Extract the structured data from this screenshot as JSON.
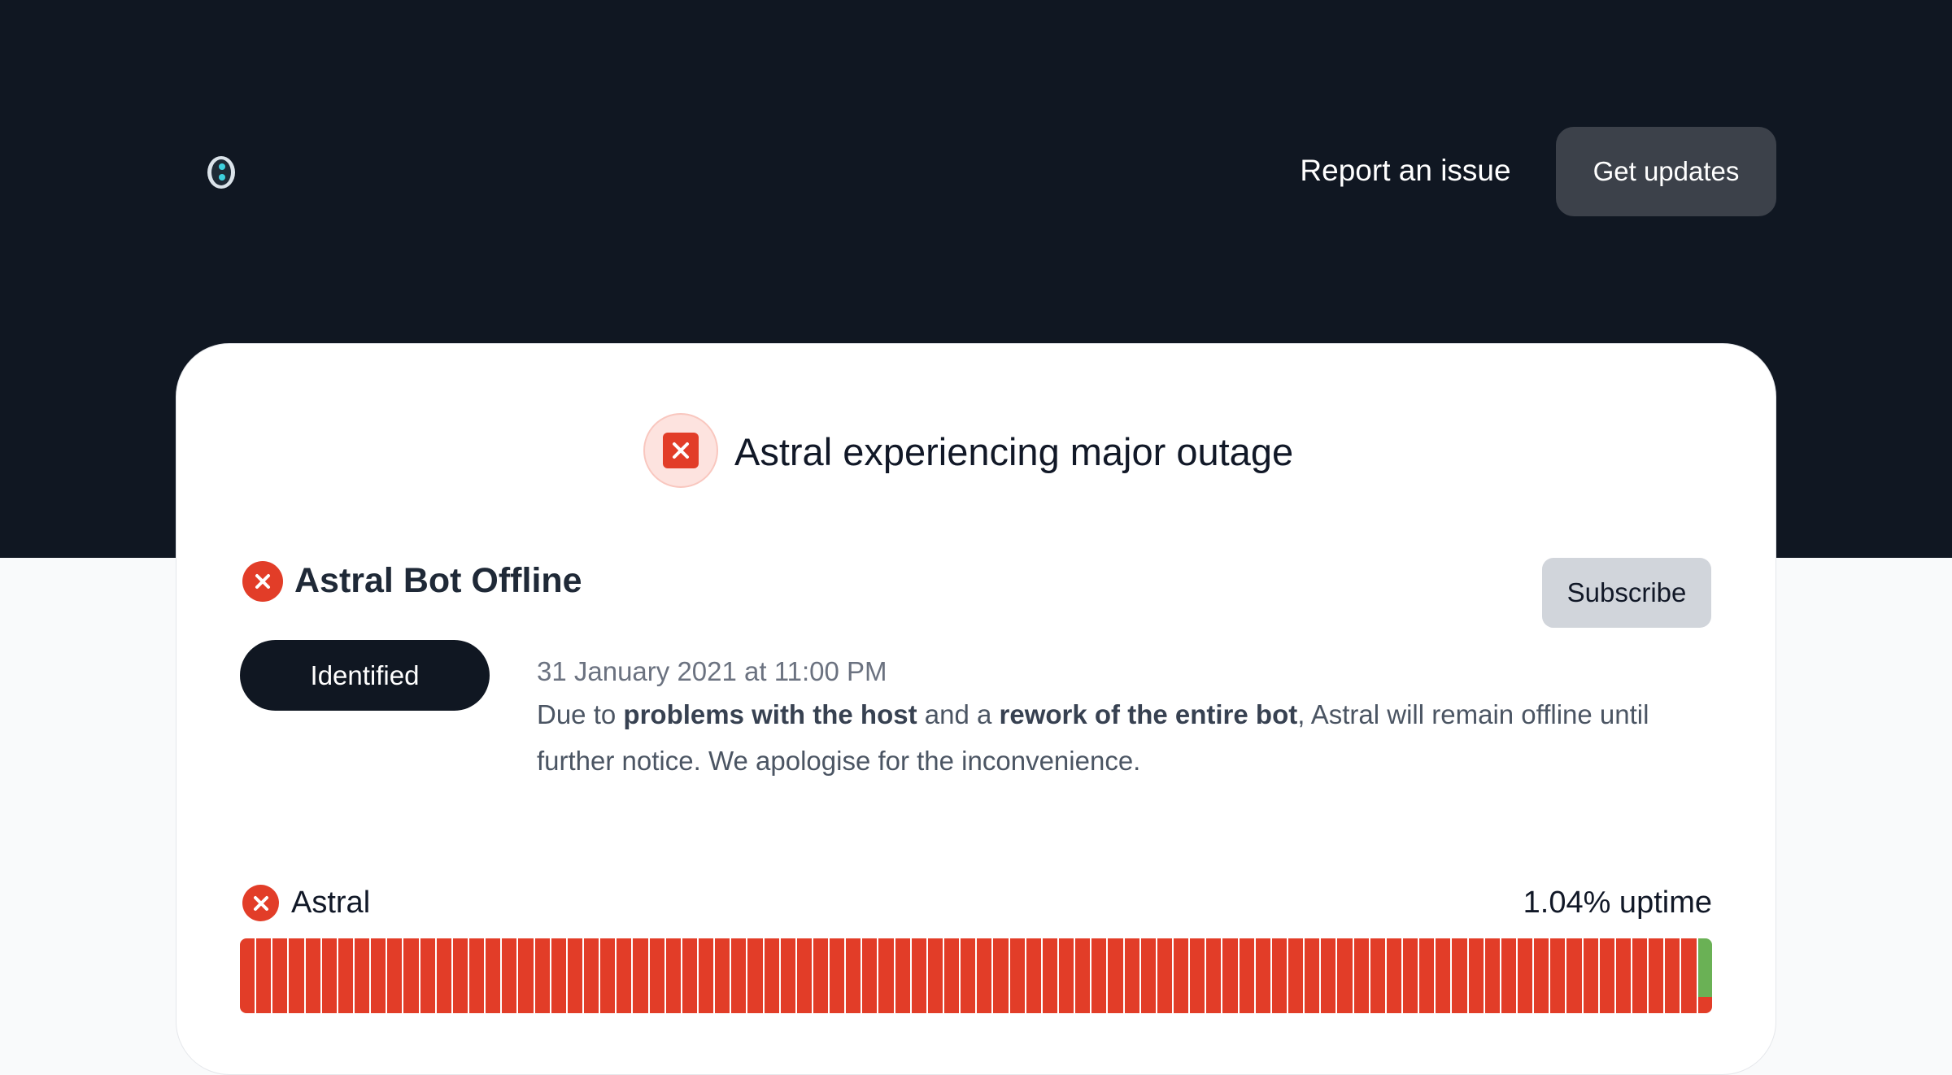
{
  "header": {
    "logo_icon": "astral-logo-icon",
    "report_link": "Report an issue",
    "get_updates_button": "Get updates"
  },
  "banner": {
    "icon": "x-square-icon",
    "title": "Astral experiencing major outage",
    "status_color": "#e23d28"
  },
  "incident": {
    "icon": "x-circle-icon",
    "title": "Astral Bot Offline",
    "subscribe_label": "Subscribe",
    "status_pill": "Identified",
    "update_time": "31 January 2021 at 11:00 PM",
    "body_parts": [
      {
        "text": "Due to ",
        "bold": false
      },
      {
        "text": "problems with the host",
        "bold": true
      },
      {
        "text": " and a ",
        "bold": false
      },
      {
        "text": "rework of the entire bot",
        "bold": true
      },
      {
        "text": ", Astral will remain offline until further notice. We apologise for the inconvenience.",
        "bold": false
      }
    ]
  },
  "component": {
    "icon": "x-circle-icon",
    "name": "Astral",
    "uptime_label": "1.04% uptime",
    "uptime_days": [
      "outage",
      "outage",
      "outage",
      "outage",
      "outage",
      "outage",
      "outage",
      "outage",
      "outage",
      "outage",
      "outage",
      "outage",
      "outage",
      "outage",
      "outage",
      "outage",
      "outage",
      "outage",
      "outage",
      "outage",
      "outage",
      "outage",
      "outage",
      "outage",
      "outage",
      "outage",
      "outage",
      "outage",
      "outage",
      "outage",
      "outage",
      "outage",
      "outage",
      "outage",
      "outage",
      "outage",
      "outage",
      "outage",
      "outage",
      "outage",
      "outage",
      "outage",
      "outage",
      "outage",
      "outage",
      "outage",
      "outage",
      "outage",
      "outage",
      "outage",
      "outage",
      "outage",
      "outage",
      "outage",
      "outage",
      "outage",
      "outage",
      "outage",
      "outage",
      "outage",
      "outage",
      "outage",
      "outage",
      "outage",
      "outage",
      "outage",
      "outage",
      "outage",
      "outage",
      "outage",
      "outage",
      "outage",
      "outage",
      "outage",
      "outage",
      "outage",
      "outage",
      "outage",
      "outage",
      "outage",
      "outage",
      "outage",
      "outage",
      "outage",
      "outage",
      "outage",
      "outage",
      "outage",
      "outage",
      "partial"
    ],
    "colors": {
      "outage": "#e23d28",
      "operational": "#6ab155"
    }
  }
}
